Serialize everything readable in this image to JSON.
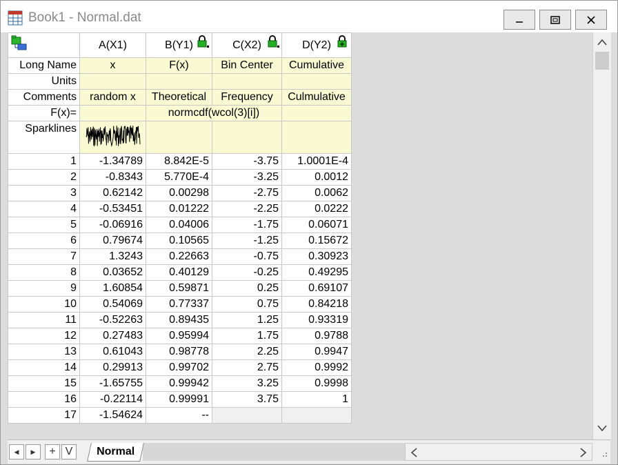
{
  "window": {
    "title": "Book1 - Normal.dat"
  },
  "columns": [
    {
      "short": "A(X1)",
      "long_name": "x",
      "units": "",
      "comments": "random x",
      "locked": false
    },
    {
      "short": "B(Y1)",
      "long_name": "F(x)",
      "units": "",
      "comments": "Theoretical",
      "locked": true
    },
    {
      "short": "C(X2)",
      "long_name": "Bin Center",
      "units": "",
      "comments": "Frequency",
      "locked": true
    },
    {
      "short": "D(Y2)",
      "long_name": "Cumulative",
      "units": "",
      "comments": "Culmulative",
      "locked": true
    }
  ],
  "row_labels": {
    "long_name": "Long Name",
    "units": "Units",
    "comments": "Comments",
    "fx": "F(x)=",
    "sparklines": "Sparklines"
  },
  "formula": "normcdf(wcol(3)[i])",
  "rows": [
    [
      "1",
      "-1.34789",
      "8.842E-5",
      "-3.75",
      "1.0001E-4"
    ],
    [
      "2",
      "-0.8343",
      "5.770E-4",
      "-3.25",
      "0.0012"
    ],
    [
      "3",
      "0.62142",
      "0.00298",
      "-2.75",
      "0.0062"
    ],
    [
      "4",
      "-0.53451",
      "0.01222",
      "-2.25",
      "0.0222"
    ],
    [
      "5",
      "-0.06916",
      "0.04006",
      "-1.75",
      "0.06071"
    ],
    [
      "6",
      "0.79674",
      "0.10565",
      "-1.25",
      "0.15672"
    ],
    [
      "7",
      "1.3243",
      "0.22663",
      "-0.75",
      "0.30923"
    ],
    [
      "8",
      "0.03652",
      "0.40129",
      "-0.25",
      "0.49295"
    ],
    [
      "9",
      "1.60854",
      "0.59871",
      "0.25",
      "0.69107"
    ],
    [
      "10",
      "0.54069",
      "0.77337",
      "0.75",
      "0.84218"
    ],
    [
      "11",
      "-0.52263",
      "0.89435",
      "1.25",
      "0.93319"
    ],
    [
      "12",
      "0.27483",
      "0.95994",
      "1.75",
      "0.9788"
    ],
    [
      "13",
      "0.61043",
      "0.98778",
      "2.25",
      "0.9947"
    ],
    [
      "14",
      "0.29913",
      "0.99702",
      "2.75",
      "0.9992"
    ],
    [
      "15",
      "-1.65755",
      "0.99942",
      "3.25",
      "0.9998"
    ],
    [
      "16",
      "-0.22114",
      "0.99991",
      "3.75",
      "1"
    ],
    [
      "17",
      "-1.54624",
      "--",
      "",
      ""
    ]
  ],
  "sheet_tab": "Normal",
  "nav_buttons": [
    "◀",
    "▶",
    "+",
    "V"
  ],
  "colors": {
    "meta_bg": "#fafad2",
    "lock_green": "#22b022"
  }
}
